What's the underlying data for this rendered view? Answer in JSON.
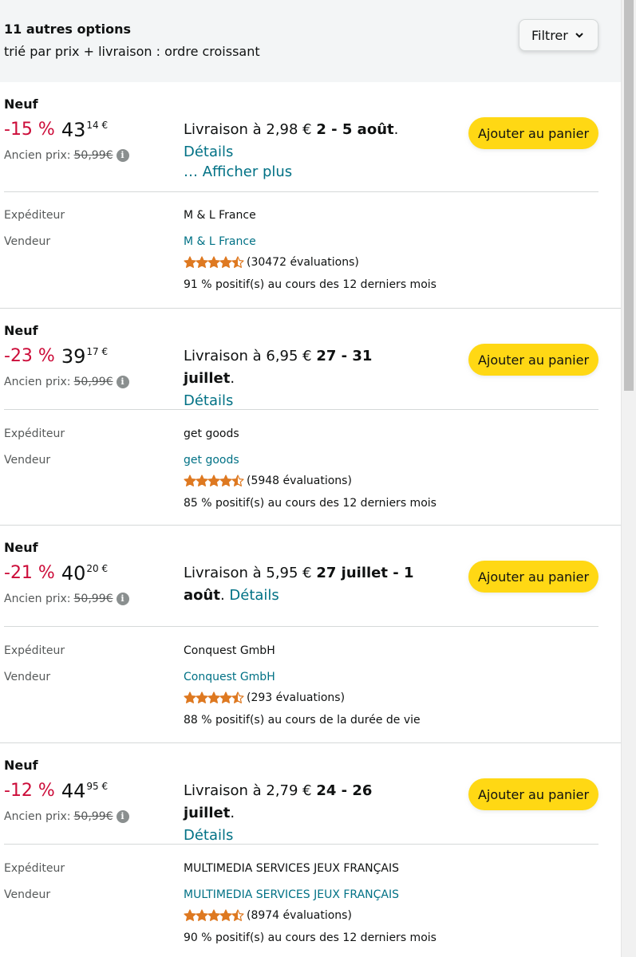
{
  "header": {
    "count": "11 autres options",
    "sort": "trié par prix + livraison : ordre croissant",
    "filter_label": "Filtrer"
  },
  "colors": {
    "discount": "#cc0c39",
    "link": "#007185",
    "button": "#ffd814",
    "star": "#de7921"
  },
  "labels": {
    "old_price": "Ancien prix:",
    "shipper": "Expéditeur",
    "seller": "Vendeur",
    "add_to_cart": "Ajouter au panier",
    "details": "Détails",
    "show_more": "… Afficher plus"
  },
  "offers": [
    {
      "condition": "Neuf",
      "discount": "-15 %",
      "price_whole": "43",
      "price_fraction": "14 €",
      "old_price": "50,99€",
      "delivery_prefix": "Livraison à 2,98 € ",
      "delivery_dates": "2 - 5 août",
      "delivery_suffix": ".",
      "shipper": "M & L France",
      "seller": "M & L France",
      "rating_stars": 4.5,
      "ratings": "(30472 évaluations)",
      "positive": "91 % positif(s) au cours des 12 derniers mois"
    },
    {
      "condition": "Neuf",
      "discount": "-23 %",
      "price_whole": "39",
      "price_fraction": "17 €",
      "old_price": "50,99€",
      "delivery_prefix": "Livraison à 6,95 € ",
      "delivery_dates": "27 - 31 juillet",
      "delivery_suffix": ".",
      "shipper": "get goods",
      "seller": "get goods",
      "rating_stars": 4.5,
      "ratings": "(5948 évaluations)",
      "positive": "85 % positif(s) au cours des 12 derniers mois"
    },
    {
      "condition": "Neuf",
      "discount": "-21 %",
      "price_whole": "40",
      "price_fraction": "20 €",
      "old_price": "50,99€",
      "delivery_prefix": "Livraison à 5,95 € ",
      "delivery_dates": "27 juillet - 1 août",
      "delivery_suffix": ".",
      "shipper": "Conquest GmbH",
      "seller": "Conquest GmbH",
      "rating_stars": 4.5,
      "ratings": "(293 évaluations)",
      "positive": "88 % positif(s) au cours de la durée de vie"
    },
    {
      "condition": "Neuf",
      "discount": "-12 %",
      "price_whole": "44",
      "price_fraction": "95 €",
      "old_price": "50,99€",
      "delivery_prefix": "Livraison à 2,79 € ",
      "delivery_dates": "24 - 26 juillet",
      "delivery_suffix": ".",
      "shipper": "MULTIMEDIA SERVICES JEUX FRANÇAIS",
      "seller": "MULTIMEDIA SERVICES JEUX FRANÇAIS",
      "rating_stars": 4.5,
      "ratings": "(8974 évaluations)",
      "positive": "90 % positif(s) au cours des 12 derniers mois"
    }
  ]
}
